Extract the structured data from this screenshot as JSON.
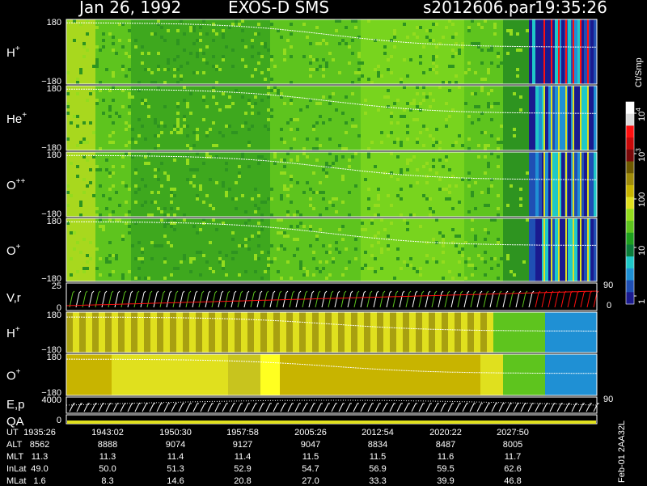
{
  "header": {
    "date": "Jan 26, 1992",
    "title": "EXOS-D SMS",
    "file": "s2012606.par",
    "time": "19:35:26"
  },
  "colors": {
    "background": "#000000",
    "foreground": "#ffffff",
    "colorbar": [
      "#1a1a8f",
      "#1f4fb4",
      "#1f90d4",
      "#1fc8c8",
      "#0b7d3a",
      "#1ea01e",
      "#5ec41e",
      "#94dc1e",
      "#e0e01e",
      "#c8b400",
      "#a08c0a",
      "#6e5a00",
      "#7a0a0a",
      "#c80a0a",
      "#ff1010",
      "#dcdcdc",
      "#ffffff"
    ]
  },
  "colorbar": {
    "unit": "Ct/Smp",
    "ticks": [
      "10^4",
      "10^3",
      "100",
      "10",
      "1"
    ]
  },
  "chart_data": {
    "type": "heatmap",
    "panels": [
      {
        "label": "H",
        "sup": "+",
        "ytop": "180",
        "ybot": "−180",
        "ylim": [
          -180,
          180
        ]
      },
      {
        "label": "He",
        "sup": "+",
        "ytop": "180",
        "ybot": "−180",
        "ylim": [
          -180,
          180
        ]
      },
      {
        "label": "O",
        "sup": "++",
        "ytop": "180",
        "ybot": "−180",
        "ylim": [
          -180,
          180
        ]
      },
      {
        "label": "O",
        "sup": "+",
        "ytop": "180",
        "ybot": "−180",
        "ylim": [
          -180,
          180
        ]
      },
      {
        "label": "V,r",
        "sup": "",
        "ytop": "25",
        "ybot": "0",
        "ylim": [
          0,
          25
        ],
        "right_top": "90",
        "right_bot": "0"
      },
      {
        "label": "H",
        "sup": "+",
        "ytop": "180",
        "ybot": "−180",
        "ylim": [
          -180,
          180
        ]
      },
      {
        "label": "O",
        "sup": "+",
        "ytop": "180",
        "ybot": "−180",
        "ylim": [
          -180,
          180
        ]
      },
      {
        "label": "E,p",
        "sup": "",
        "ytop": "4000",
        "ybot": "",
        "ylim": [
          0,
          4000
        ],
        "right_top": "90"
      },
      {
        "label": "QA",
        "sup": "",
        "ytop": "",
        "ybot": "0"
      }
    ],
    "x_labels": {
      "UT": [
        "1935:26",
        "1943:02",
        "1950:30",
        "1957:58",
        "2005:26",
        "2012:54",
        "2020:22",
        "2027:50"
      ],
      "ALT": [
        "8562",
        "8888",
        "9074",
        "9127",
        "9047",
        "8834",
        "8487",
        "8005"
      ],
      "MLT": [
        "11.3",
        "11.3",
        "11.4",
        "11.4",
        "11.5",
        "11.5",
        "11.6",
        "11.7"
      ],
      "InLat": [
        "49.0",
        "50.0",
        "51.3",
        "52.9",
        "54.7",
        "56.9",
        "59.5",
        "62.6"
      ],
      "MLat": [
        "1.6",
        "8.3",
        "14.6",
        "20.8",
        "27.0",
        "33.3",
        "39.9",
        "46.8"
      ]
    },
    "row_names": [
      "UT",
      "ALT",
      "MLT",
      "InLat",
      "MLat"
    ],
    "footer_vertical": "Feb-01 2AA32L"
  }
}
